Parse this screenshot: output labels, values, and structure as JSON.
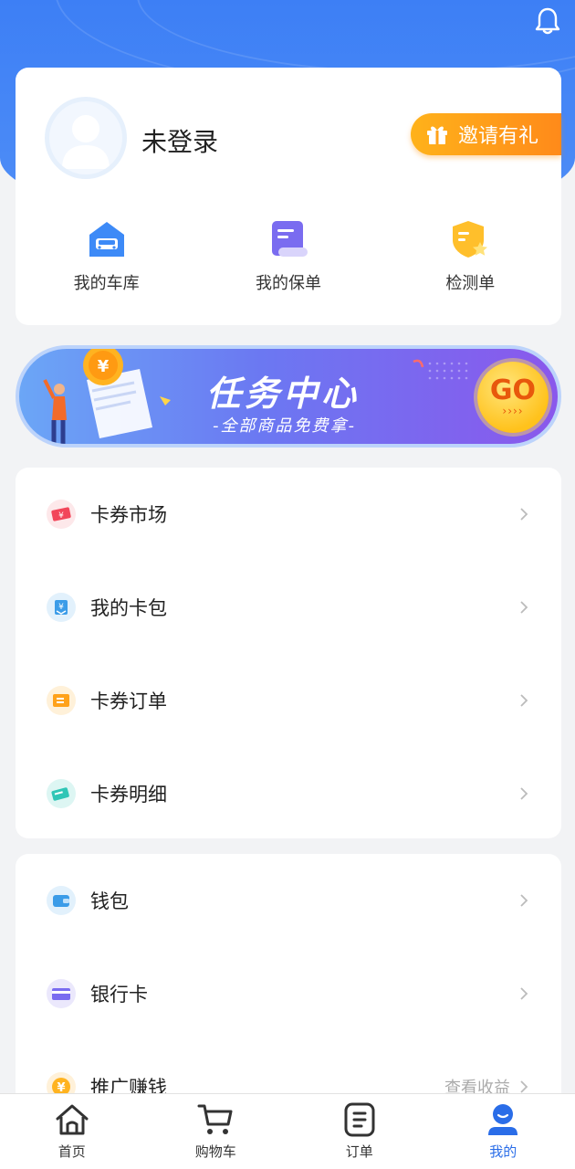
{
  "colors": {
    "primary_blue": "#3d7ff5",
    "invite_orange": "#ffa21a",
    "active_tab": "#2a6de8"
  },
  "header": {
    "bell_icon": "bell-icon"
  },
  "profile": {
    "login_status": "未登录",
    "invite_label": "邀请有礼",
    "quick_links": [
      {
        "label": "我的车库",
        "icon": "garage-icon"
      },
      {
        "label": "我的保单",
        "icon": "policy-icon"
      },
      {
        "label": "检测单",
        "icon": "inspection-icon"
      }
    ]
  },
  "banner": {
    "title": "任务中心",
    "subtitle": "-全部商品免费拿-",
    "go_label": "GO",
    "go_arrows": "››››"
  },
  "menu_group_1": [
    {
      "label": "卡券市场",
      "icon": "coupon-market-icon"
    },
    {
      "label": "我的卡包",
      "icon": "card-wallet-icon"
    },
    {
      "label": "卡券订单",
      "icon": "coupon-order-icon"
    },
    {
      "label": "卡券明细",
      "icon": "coupon-detail-icon"
    }
  ],
  "menu_group_2": [
    {
      "label": "钱包",
      "icon": "wallet-icon",
      "extra": ""
    },
    {
      "label": "银行卡",
      "icon": "bank-card-icon",
      "extra": ""
    },
    {
      "label": "推广赚钱",
      "icon": "promote-icon",
      "extra": "查看收益"
    }
  ],
  "tabbar": [
    {
      "label": "首页",
      "icon": "home-icon"
    },
    {
      "label": "购物车",
      "icon": "cart-icon"
    },
    {
      "label": "订单",
      "icon": "order-icon"
    },
    {
      "label": "我的",
      "icon": "profile-icon",
      "active": true
    }
  ]
}
